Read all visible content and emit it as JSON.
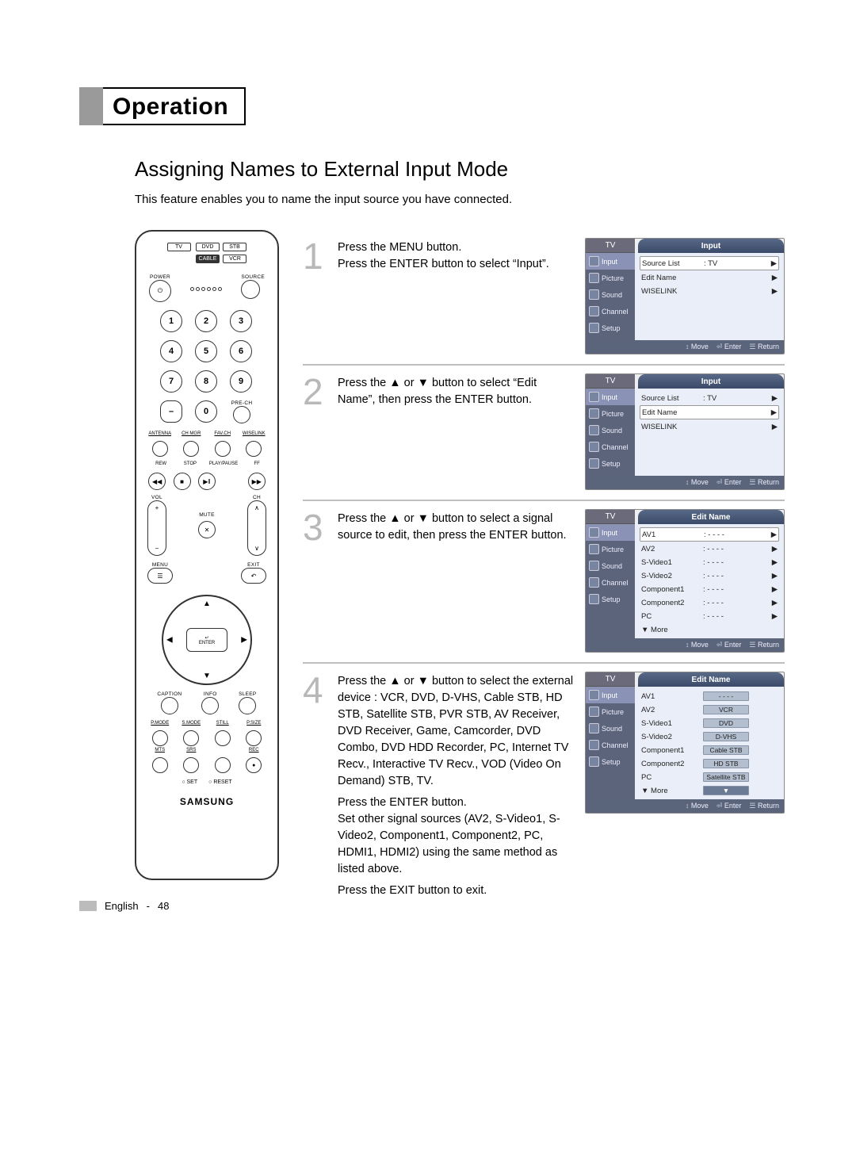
{
  "header": {
    "title": "Operation"
  },
  "section": {
    "title": "Assigning Names to External Input Mode",
    "intro": "This feature enables you to name the input source you have connected."
  },
  "steps": [
    {
      "num": "1",
      "paragraphs": [
        "Press the MENU button.\nPress the ENTER button to select “Input”."
      ],
      "osd": {
        "tv": "TV",
        "title": "Input",
        "side": [
          "Input",
          "Picture",
          "Sound",
          "Channel",
          "Setup"
        ],
        "activeSide": 0,
        "rows": [
          {
            "c1": "Source List",
            "c2": ": TV",
            "arr": "▶",
            "sel": true
          },
          {
            "c1": "Edit Name",
            "c2": "",
            "arr": "▶"
          },
          {
            "c1": "WISELINK",
            "c2": "",
            "arr": "▶"
          }
        ],
        "foot": [
          {
            "k": "↕",
            "l": "Move"
          },
          {
            "k": "⏎",
            "l": "Enter"
          },
          {
            "k": "☰",
            "l": "Return"
          }
        ]
      }
    },
    {
      "num": "2",
      "paragraphs": [
        "Press the ▲ or ▼ button to select “Edit Name”, then press the ENTER button."
      ],
      "osd": {
        "tv": "TV",
        "title": "Input",
        "side": [
          "Input",
          "Picture",
          "Sound",
          "Channel",
          "Setup"
        ],
        "activeSide": 0,
        "rows": [
          {
            "c1": "Source List",
            "c2": ": TV",
            "arr": "▶"
          },
          {
            "c1": "Edit Name",
            "c2": "",
            "arr": "▶",
            "sel": true
          },
          {
            "c1": "WISELINK",
            "c2": "",
            "arr": "▶"
          }
        ],
        "foot": [
          {
            "k": "↕",
            "l": "Move"
          },
          {
            "k": "⏎",
            "l": "Enter"
          },
          {
            "k": "☰",
            "l": "Return"
          }
        ]
      }
    },
    {
      "num": "3",
      "paragraphs": [
        "Press the ▲ or ▼ button to select a signal source to edit, then press the ENTER button."
      ],
      "osd": {
        "tv": "TV",
        "title": "Edit Name",
        "side": [
          "Input",
          "Picture",
          "Sound",
          "Channel",
          "Setup"
        ],
        "activeSide": 0,
        "rows": [
          {
            "c1": "AV1",
            "c2": ": - - - -",
            "arr": "▶",
            "sel": true
          },
          {
            "c1": "AV2",
            "c2": ": - - - -",
            "arr": "▶"
          },
          {
            "c1": "S-Video1",
            "c2": ": - - - -",
            "arr": "▶"
          },
          {
            "c1": "S-Video2",
            "c2": ": - - - -",
            "arr": "▶"
          },
          {
            "c1": "Component1",
            "c2": ": - - - -",
            "arr": "▶"
          },
          {
            "c1": "Component2",
            "c2": ": - - - -",
            "arr": "▶"
          },
          {
            "c1": "PC",
            "c2": ": - - - -",
            "arr": "▶"
          },
          {
            "c1": "▼ More",
            "c2": "",
            "arr": ""
          }
        ],
        "foot": [
          {
            "k": "↕",
            "l": "Move"
          },
          {
            "k": "⏎",
            "l": "Enter"
          },
          {
            "k": "☰",
            "l": "Return"
          }
        ]
      }
    },
    {
      "num": "4",
      "paragraphs": [
        "Press the ▲ or ▼ button to select the external device : VCR, DVD, D-VHS, Cable STB, HD STB, Satellite STB, PVR STB, AV Receiver, DVD Receiver, Game, Camcorder, DVD Combo, DVD HDD Recorder, PC, Internet TV Recv., Interactive TV Recv., VOD (Video On Demand) STB, TV.",
        "Press the ENTER button.\nSet other signal sources (AV2, S-Video1, S-Video2, Component1, Component2, PC, HDMI1, HDMI2) using the same method as listed above.",
        "Press the EXIT button to exit."
      ],
      "osd": {
        "tv": "TV",
        "title": "Edit Name",
        "side": [
          "Input",
          "Picture",
          "Sound",
          "Channel",
          "Setup"
        ],
        "activeSide": 0,
        "rows": [
          {
            "c1": "AV1",
            "tag": "- - - -",
            "arr": ""
          },
          {
            "c1": "AV2",
            "tag": "VCR",
            "arr": ""
          },
          {
            "c1": "S-Video1",
            "tag": "DVD",
            "arr": ""
          },
          {
            "c1": "S-Video2",
            "tag": "D-VHS",
            "arr": ""
          },
          {
            "c1": "Component1",
            "tag": "Cable STB",
            "arr": ""
          },
          {
            "c1": "Component2",
            "tag": "HD STB",
            "arr": ""
          },
          {
            "c1": "PC",
            "tag": "Satellite STB",
            "arr": ""
          },
          {
            "c1": "▼ More",
            "taghi": "▼",
            "arr": ""
          }
        ],
        "foot": [
          {
            "k": "↕",
            "l": "Move"
          },
          {
            "k": "⏎",
            "l": "Enter"
          },
          {
            "k": "☰",
            "l": "Return"
          }
        ]
      }
    }
  ],
  "remote": {
    "devTop": [
      "DVD",
      "STB"
    ],
    "devLeft": "TV",
    "devBottom": [
      "CABLE",
      "VCR"
    ],
    "power": "POWER",
    "source": "SOURCE",
    "nums": [
      "1",
      "2",
      "3",
      "4",
      "5",
      "6",
      "7",
      "8",
      "9"
    ],
    "dash": "–",
    "zero": "0",
    "prech": "PRE-CH",
    "row4": [
      "ANTENNA",
      "CH MGR",
      "FAV.CH",
      "WISELINK"
    ],
    "trLabels": [
      "REW",
      "STOP",
      "PLAY/PAUSE",
      "FF"
    ],
    "trans": [
      "◀◀",
      "■",
      "▶‖",
      "▶▶"
    ],
    "vol": "VOL",
    "ch": "CH",
    "mute": "MUTE",
    "menu": "MENU",
    "exit": "EXIT",
    "enterTop": "↵",
    "enter": "ENTER",
    "row3": [
      "CAPTION",
      "INFO",
      "SLEEP"
    ],
    "row4b_l": [
      "P.MODE",
      "S.MODE",
      "STILL",
      "P.SIZE"
    ],
    "row4c_l": [
      "MTS",
      "SRS",
      "",
      "REC"
    ],
    "setreset": [
      "○ SET",
      "○ RESET"
    ],
    "brand": "SAMSUNG"
  },
  "footer": {
    "lang": "English",
    "page": "48"
  }
}
